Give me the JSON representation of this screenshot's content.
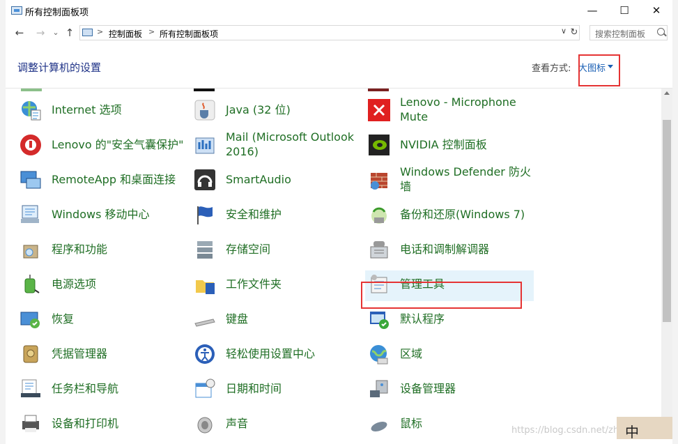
{
  "window": {
    "title": "所有控制面板项"
  },
  "nav": {
    "back": "←",
    "forward": "→",
    "up": "↑",
    "dropdown": "∨",
    "refresh": "↻"
  },
  "address": {
    "crumbs": [
      "控制面板",
      "所有控制面板项"
    ],
    "separator": ">"
  },
  "search": {
    "placeholder": "搜索控制面板"
  },
  "header": {
    "heading": "调整计算机的设置",
    "view_label": "查看方式:",
    "view_value": "大图标"
  },
  "items": [
    {
      "label": "Internet 选项",
      "icon": "globe-settings-icon"
    },
    {
      "label": "Java (32 位)",
      "icon": "java-cup-icon"
    },
    {
      "label": "Lenovo - Microphone Mute",
      "icon": "microphone-mute-icon"
    },
    {
      "label": "Lenovo 的\"安全气囊保护\"",
      "icon": "lenovo-airbag-icon"
    },
    {
      "label": "Mail (Microsoft Outlook 2016)",
      "icon": "mail-icon"
    },
    {
      "label": "NVIDIA 控制面板",
      "icon": "nvidia-icon"
    },
    {
      "label": "RemoteApp 和桌面连接",
      "icon": "remoteapp-icon"
    },
    {
      "label": "SmartAudio",
      "icon": "headphones-icon"
    },
    {
      "label": "Windows Defender 防火墙",
      "icon": "firewall-icon"
    },
    {
      "label": "Windows 移动中心",
      "icon": "mobility-center-icon"
    },
    {
      "label": "安全和维护",
      "icon": "flag-icon"
    },
    {
      "label": "备份和还原(Windows 7)",
      "icon": "backup-icon"
    },
    {
      "label": "程序和功能",
      "icon": "programs-icon"
    },
    {
      "label": "存储空间",
      "icon": "storage-icon"
    },
    {
      "label": "电话和调制解调器",
      "icon": "phone-modem-icon"
    },
    {
      "label": "电源选项",
      "icon": "power-icon"
    },
    {
      "label": "工作文件夹",
      "icon": "work-folders-icon"
    },
    {
      "label": "管理工具",
      "icon": "admin-tools-icon"
    },
    {
      "label": "恢复",
      "icon": "recovery-icon"
    },
    {
      "label": "键盘",
      "icon": "keyboard-icon"
    },
    {
      "label": "默认程序",
      "icon": "default-programs-icon"
    },
    {
      "label": "凭据管理器",
      "icon": "credential-icon"
    },
    {
      "label": "轻松使用设置中心",
      "icon": "ease-of-access-icon"
    },
    {
      "label": "区域",
      "icon": "region-icon"
    },
    {
      "label": "任务栏和导航",
      "icon": "taskbar-icon"
    },
    {
      "label": "日期和时间",
      "icon": "date-time-icon"
    },
    {
      "label": "设备管理器",
      "icon": "device-manager-icon"
    },
    {
      "label": "设备和打印机",
      "icon": "printer-icon"
    },
    {
      "label": "声音",
      "icon": "speaker-icon"
    },
    {
      "label": "鼠标",
      "icon": "mouse-icon"
    }
  ],
  "watermark": "https://blog.csdn.net/zhuzi_zhuzi",
  "corner_text": "中"
}
